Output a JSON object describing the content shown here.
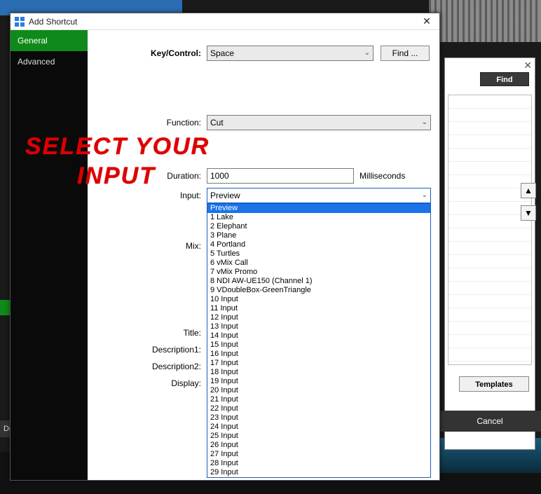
{
  "bg": {
    "de_tab": "De"
  },
  "right_panel": {
    "find_label": "Find",
    "templates_label": "Templates",
    "cancel_label": "Cancel",
    "arrow_up": "▲",
    "arrow_down": "▼",
    "close": "✕"
  },
  "dialog": {
    "title": "Add Shortcut",
    "close": "✕",
    "sidebar": {
      "general": "General",
      "advanced": "Advanced"
    },
    "labels": {
      "key_control": "Key/Control:",
      "function": "Function:",
      "duration": "Duration:",
      "milliseconds": "Milliseconds",
      "input": "Input:",
      "mix": "Mix:",
      "title": "Title:",
      "description1": "Description1:",
      "description2": "Description2:",
      "display": "Display:"
    },
    "values": {
      "key_control": "Space",
      "function": "Cut",
      "duration": "1000",
      "input_selected": "Preview",
      "find_btn": "Find ..."
    },
    "input_options": [
      "Preview",
      "1 Lake",
      "2 Elephant",
      "3 Plane",
      "4 Portland",
      "5 Turtles",
      "6 vMix Call",
      "7 vMix Promo",
      "8 NDI AW-UE150 (Channel 1)",
      "9 VDoubleBox-GreenTriangle",
      "10 Input",
      "11 Input",
      "12 Input",
      "13 Input",
      "14 Input",
      "15 Input",
      "16 Input",
      "17 Input",
      "18 Input",
      "19 Input",
      "20 Input",
      "21 Input",
      "22 Input",
      "23 Input",
      "24 Input",
      "25 Input",
      "26 Input",
      "27 Input",
      "28 Input",
      "29 Input"
    ]
  },
  "overlay": {
    "line1": "Select Your",
    "line2": "Input"
  }
}
